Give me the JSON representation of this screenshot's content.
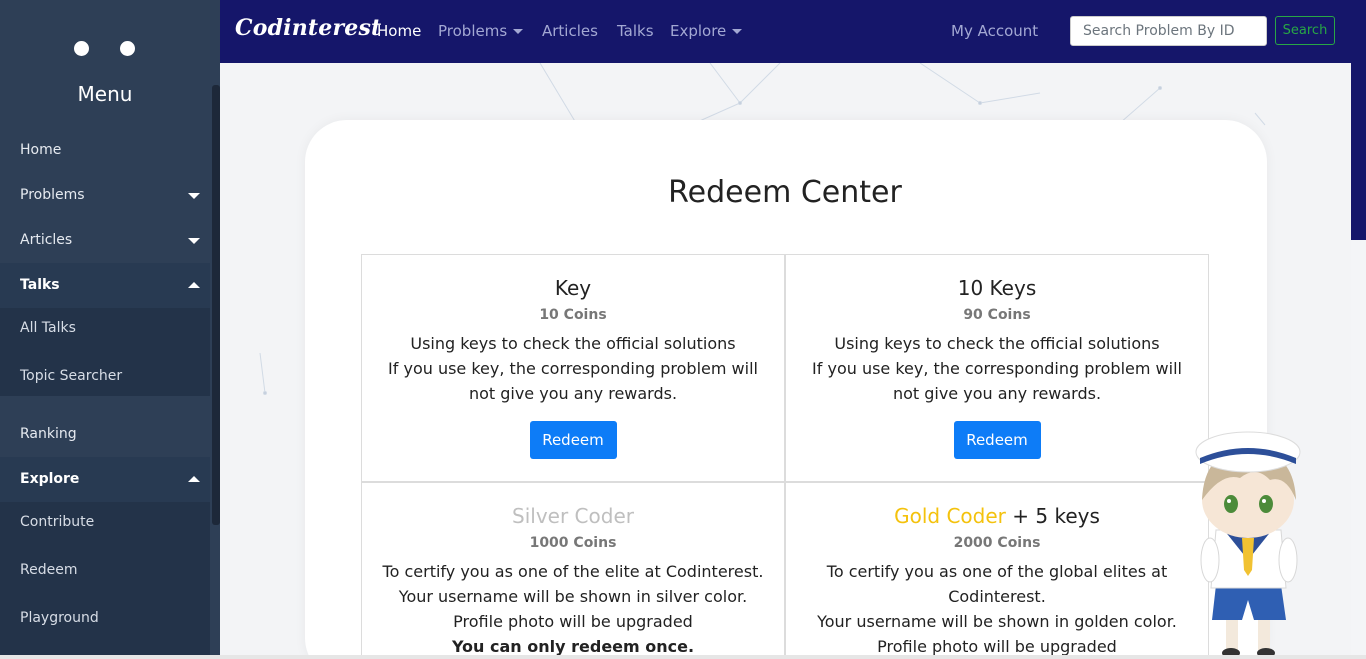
{
  "sidebar": {
    "title": "Menu",
    "items": {
      "home": "Home",
      "problems": "Problems",
      "articles": "Articles",
      "talks": "Talks",
      "all_talks": "All Talks",
      "topic_searcher": "Topic Searcher",
      "ranking": "Ranking",
      "explore": "Explore",
      "contribute": "Contribute",
      "redeem": "Redeem",
      "playground": "Playground"
    }
  },
  "topnav": {
    "brand": "Codinterest",
    "home": "Home",
    "problems": "Problems",
    "articles": "Articles",
    "talks": "Talks",
    "explore": "Explore",
    "my_account": "My Account",
    "search_placeholder": "Search Problem By ID",
    "search_button": "Search"
  },
  "main": {
    "title": "Redeem Center",
    "items": [
      {
        "name": "Key",
        "price": "10 Coins",
        "desc": [
          "Using keys to check the official solutions",
          "If you use key, the corresponding problem will",
          "not give you any rewards."
        ],
        "button": "Redeem"
      },
      {
        "name": "10 Keys",
        "price": "90 Coins",
        "desc": [
          "Using keys to check the official solutions",
          "If you use key, the corresponding problem will",
          "not give you any rewards."
        ],
        "button": "Redeem"
      },
      {
        "name": "Silver Coder",
        "price": "1000 Coins",
        "desc": [
          "To certify you as one of the elite at Codinterest.",
          "Your username will be shown in silver color.",
          "Profile photo will be upgraded",
          "You can only redeem once."
        ]
      },
      {
        "name": "Gold Coder",
        "name_suffix": " + 5 keys",
        "price": "2000 Coins",
        "desc": [
          "To certify you as one of the global elites at",
          "Codinterest.",
          "Your username will be shown in golden color.",
          "Profile photo will be upgraded"
        ]
      }
    ]
  },
  "colors": {
    "navbar": "#15166a",
    "sidebar": "#2e3f56",
    "button_primary": "#0d7cf7",
    "search_green": "#28a745",
    "silver": "#bfbfbf",
    "gold": "#f4c20d"
  }
}
